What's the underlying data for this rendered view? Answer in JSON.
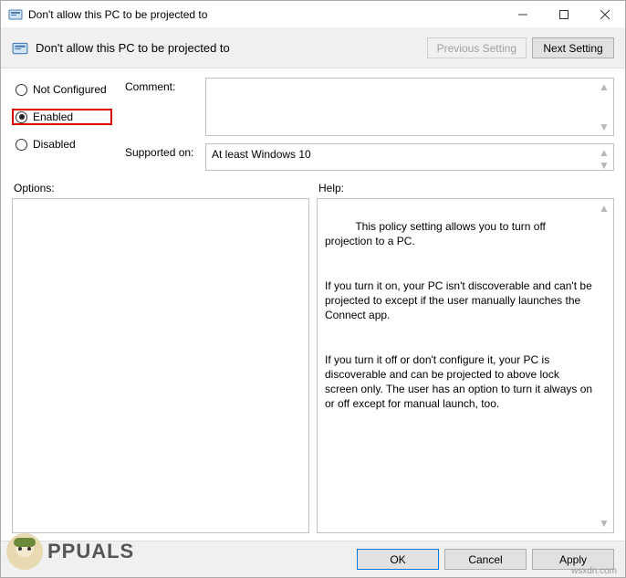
{
  "window": {
    "title": "Don't allow this PC to be projected to"
  },
  "header": {
    "title": "Don't allow this PC to be projected to",
    "prev": "Previous Setting",
    "next": "Next Setting"
  },
  "radios": {
    "not_configured": "Not Configured",
    "enabled": "Enabled",
    "disabled": "Disabled",
    "selected": "enabled"
  },
  "fields": {
    "comment_label": "Comment:",
    "supported_label": "Supported on:",
    "supported_value": "At least Windows 10"
  },
  "panels": {
    "options_label": "Options:",
    "help_label": "Help:",
    "help_text": "This policy setting allows you to turn off projection to a PC.\n\n\nIf you turn it on, your PC isn't discoverable and can't be projected to except if the user manually launches the Connect app.\n\n\nIf you turn it off or don't configure it, your PC is discoverable and can be projected to above lock screen only. The user has an option to turn it always on or off except for manual launch, too."
  },
  "footer": {
    "ok": "OK",
    "cancel": "Cancel",
    "apply": "Apply"
  },
  "watermark": {
    "text": "PPUALS",
    "site": "wsxdn.com"
  }
}
